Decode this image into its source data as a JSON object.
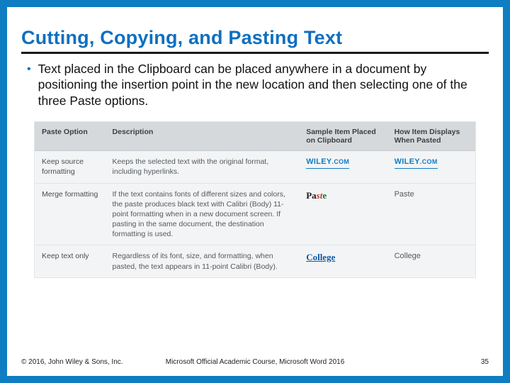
{
  "title": "Cutting, Copying, and Pasting Text",
  "bullet": "Text placed in the Clipboard can be placed anywhere in a document by positioning the insertion point in the new location and then selecting one of the three Paste options.",
  "table": {
    "headers": {
      "option": "Paste Option",
      "description": "Description",
      "sample": "Sample Item Placed on Clipboard",
      "display": "How Item Displays When Pasted"
    },
    "rows": [
      {
        "option": "Keep source formatting",
        "description": "Keeps the selected text with the original format, including hyperlinks.",
        "sample_kind": "wiley",
        "sample_brand": "WILEY",
        "sample_suffix": ".COM",
        "display_kind": "wiley",
        "display_brand": "WILEY",
        "display_suffix": ".COM"
      },
      {
        "option": "Merge formatting",
        "description": "If the text contains fonts of different sizes and colors, the paste produces black text with Calibri (Body) 11-point formatting when in a new document screen. If pasting in the same document, the destination formatting is used.",
        "sample_kind": "mixed",
        "sample_p1": "Pa",
        "sample_p2": "st",
        "sample_p3": "e",
        "display_kind": "plain",
        "display_text": "Paste"
      },
      {
        "option": "Keep text only",
        "description": "Regardless of its font, size, and formatting, when pasted, the text appears in 11-point Calibri (Body).",
        "sample_kind": "college",
        "sample_text": "College",
        "display_kind": "plain",
        "display_text": "College"
      }
    ]
  },
  "footer": {
    "left": "© 2016, John Wiley & Sons, Inc.",
    "center": "Microsoft Official Academic Course, Microsoft Word 2016",
    "right": "35"
  }
}
